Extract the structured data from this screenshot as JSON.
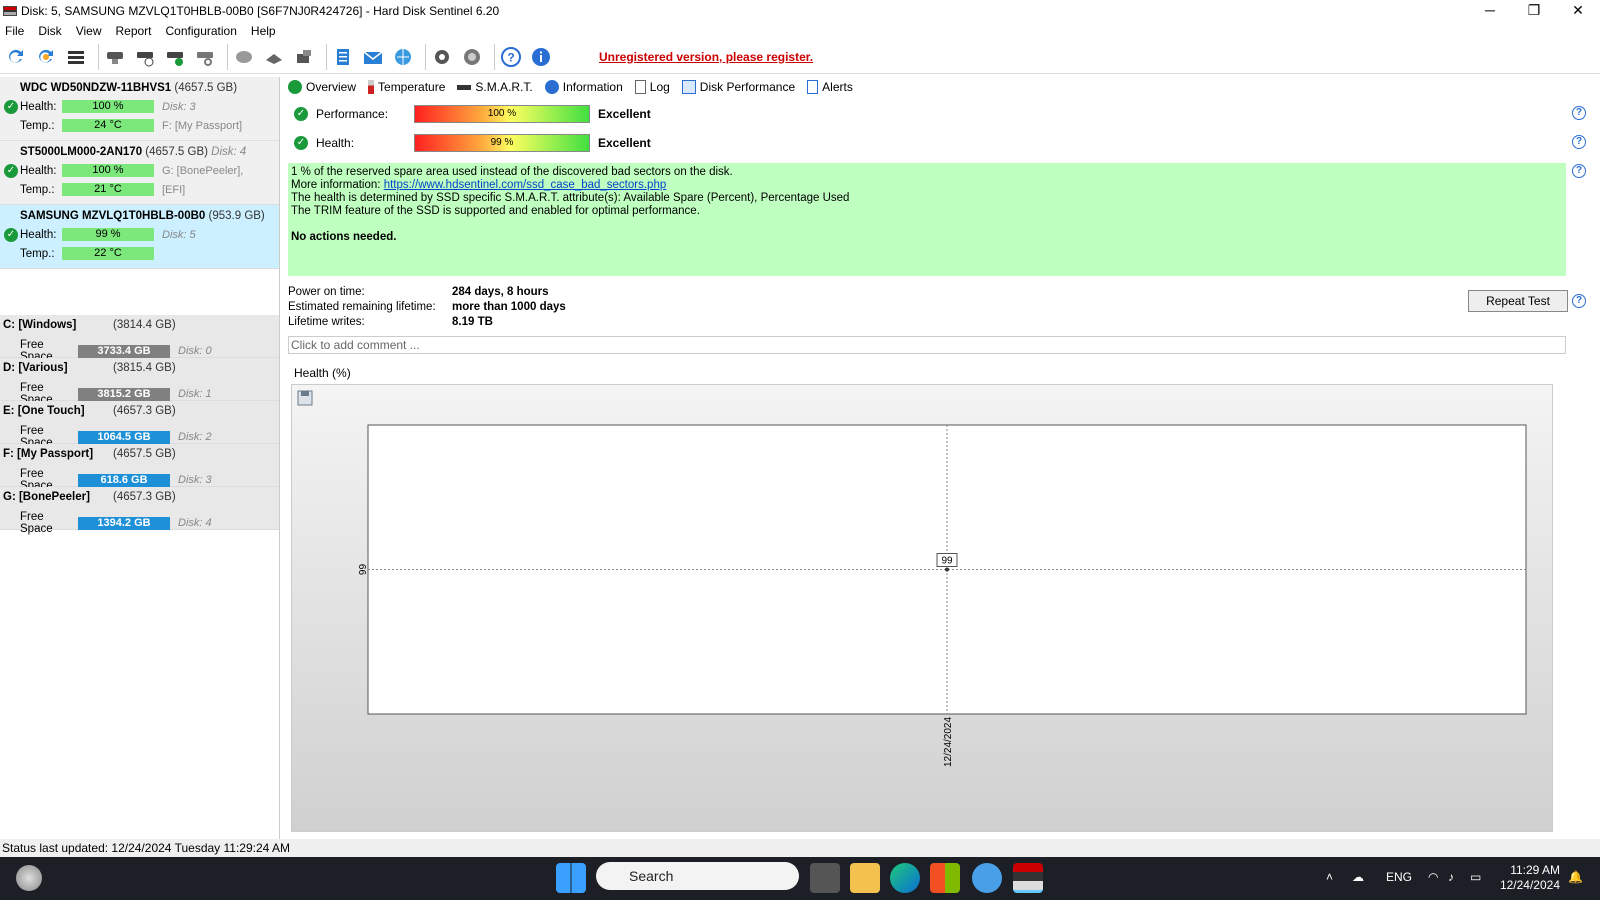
{
  "window": {
    "title": "Disk: 5, SAMSUNG MZVLQ1T0HBLB-00B0 [S6F7NJ0R424726]  -  Hard Disk Sentinel 6.20",
    "min": "─",
    "max": "❐",
    "close": "✕"
  },
  "menu": [
    "File",
    "Disk",
    "View",
    "Report",
    "Configuration",
    "Help"
  ],
  "toolbar": {
    "unregistered": "Unregistered version, please register."
  },
  "disks": [
    {
      "name": "WDC WD50NDZW-11BHVS1",
      "capacity": "(4657.5 GB)",
      "disk_label": "",
      "health": "100 %",
      "health_extra": "Disk: 3",
      "temp": "24 °C",
      "temp_extra": "F: [My Passport]",
      "selected": false
    },
    {
      "name": "ST5000LM000-2AN170",
      "capacity": "(4657.5 GB)",
      "disk_label": "Disk: 4",
      "health": "100 %",
      "health_extra": "G: [BonePeeler],",
      "temp": "21 °C",
      "temp_extra": "[EFI]",
      "selected": false
    },
    {
      "name": "SAMSUNG MZVLQ1T0HBLB-00B0",
      "capacity": "(953.9 GB)",
      "disk_label": "",
      "health": "99 %",
      "health_extra": "Disk: 5",
      "temp": "22 °C",
      "temp_extra": "",
      "selected": true
    }
  ],
  "labels": {
    "health": "Health:",
    "temp": "Temp.:",
    "free_space": "Free Space"
  },
  "volumes": [
    {
      "name": "C: [Windows]",
      "capacity": "(3814.4 GB)",
      "free": "3733.4 GB",
      "disk": "Disk: 0",
      "color": "#808080"
    },
    {
      "name": "D: [Various]",
      "capacity": "(3815.4 GB)",
      "free": "3815.2 GB",
      "disk": "Disk: 1",
      "color": "#808080"
    },
    {
      "name": "E: [One Touch]",
      "capacity": "(4657.3 GB)",
      "free": "1064.5 GB",
      "disk": "Disk: 2",
      "color": "#1e90d8"
    },
    {
      "name": "F: [My Passport]",
      "capacity": "(4657.5 GB)",
      "free": "618.6 GB",
      "disk": "Disk: 3",
      "color": "#1e90d8"
    },
    {
      "name": "G: [BonePeeler]",
      "capacity": "(4657.3 GB)",
      "free": "1394.2 GB",
      "disk": "Disk: 4",
      "color": "#1e90d8"
    }
  ],
  "tabs": [
    "Overview",
    "Temperature",
    "S.M.A.R.T.",
    "Information",
    "Log",
    "Disk Performance",
    "Alerts"
  ],
  "overview": {
    "performance_label": "Performance:",
    "performance_value": "100 %",
    "performance_pct": 100,
    "performance_text": "Excellent",
    "health_label": "Health:",
    "health_value": "99 %",
    "health_pct": 99,
    "health_text": "Excellent",
    "info_lines": [
      "1 % of the reserved spare area used instead of the discovered bad sectors on the disk."
    ],
    "info_more_prefix": "More information: ",
    "info_link": "https://www.hdsentinel.com/ssd_case_bad_sectors.php",
    "info_line3": "The health is determined by SSD specific S.M.A.R.T. attribute(s):  Available Spare (Percent), Percentage Used",
    "info_line4": "The TRIM feature of the SSD is supported and enabled for optimal performance.",
    "no_actions": "No actions needed.",
    "power_on_label": "Power on time:",
    "power_on_value": "284 days, 8 hours",
    "lifetime_label": "Estimated remaining lifetime:",
    "lifetime_value": "more than 1000 days",
    "writes_label": "Lifetime writes:",
    "writes_value": "8.19 TB",
    "repeat_test": "Repeat Test",
    "comment_placeholder": "Click to add comment ...",
    "chart_label": "Health (%)"
  },
  "chart_data": {
    "type": "line",
    "title": "Health (%)",
    "x": [
      "12/24/2024"
    ],
    "series": [
      {
        "values": [
          99
        ]
      }
    ],
    "y_ticks": [
      "99"
    ],
    "point_labels": [
      "99"
    ],
    "grid": true
  },
  "status": "Status last updated: 12/24/2024 Tuesday 11:29:24 AM",
  "taskbar": {
    "search": "Search",
    "lang": "ENG",
    "time": "11:29 AM",
    "date": "12/24/2024"
  },
  "help_glyph": "?"
}
